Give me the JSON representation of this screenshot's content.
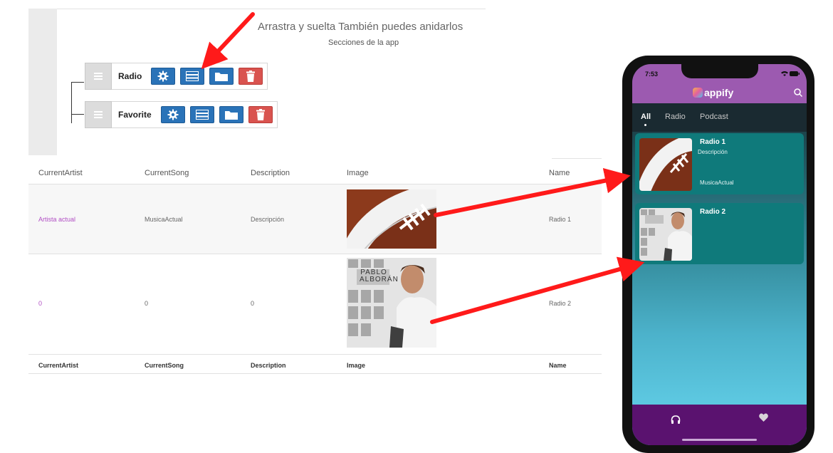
{
  "builder": {
    "heading": "Arrastra y suelta También puedes anidarlos",
    "subheading": "Secciones de la app",
    "sections": [
      {
        "label": "Radio"
      },
      {
        "label": "Favorite"
      }
    ]
  },
  "table": {
    "headers": [
      "CurrentArtist",
      "CurrentSong",
      "Description",
      "Image",
      "Name"
    ],
    "rows": [
      {
        "current_artist": "Artista actual",
        "current_song": "MusicaActual",
        "description": "Descripción",
        "name": "Radio 1"
      },
      {
        "current_artist": "0",
        "current_song": "0",
        "description": "0",
        "name": "Radio 2"
      }
    ],
    "footer": [
      "CurrentArtist",
      "CurrentSong",
      "Description",
      "Image",
      "Name"
    ],
    "album_cover_text": [
      "PABLO",
      "ALBORÁN"
    ]
  },
  "phone": {
    "time": "7:53",
    "brand": "appify",
    "tabs": [
      {
        "label": "All",
        "active": true
      },
      {
        "label": "Radio",
        "active": false
      },
      {
        "label": "Podcast",
        "active": false
      }
    ],
    "cards": [
      {
        "title": "Radio 1",
        "description": "Descripción",
        "song": "MusicaActual"
      },
      {
        "title": "Radio 2"
      }
    ],
    "colors": {
      "header": "#9c5ab0",
      "card": "#0f7a7b",
      "bottom_bar": "#5a126f",
      "accent_blue": "#2a73b8",
      "accent_red": "#d9534f",
      "link": "#b14fc4"
    }
  }
}
